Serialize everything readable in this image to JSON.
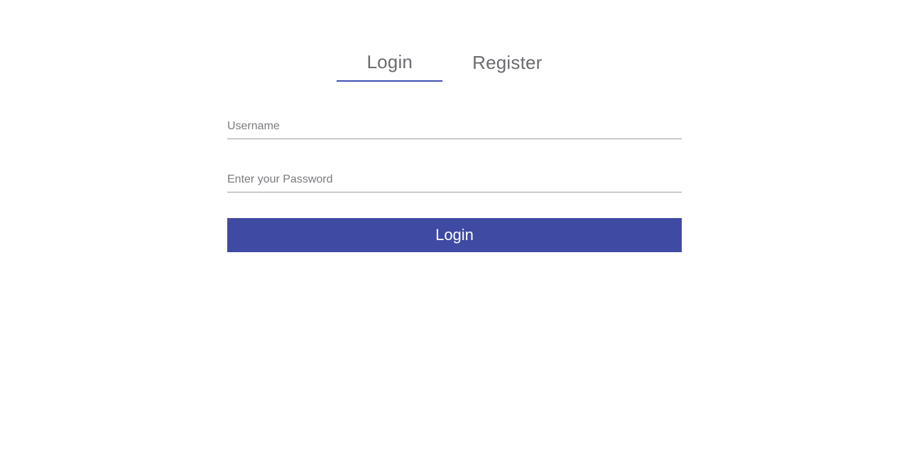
{
  "tabs": {
    "login": "Login",
    "register": "Register",
    "activeIndex": 0
  },
  "form": {
    "username": {
      "placeholder": "Username",
      "value": ""
    },
    "password": {
      "placeholder": "Enter your Password",
      "value": ""
    },
    "submitLabel": "Login"
  },
  "colors": {
    "accent": "#3f51b5",
    "buttonBg": "#3f4aa3",
    "textMuted": "#6b6b70",
    "borderMuted": "#9e9e9e"
  }
}
